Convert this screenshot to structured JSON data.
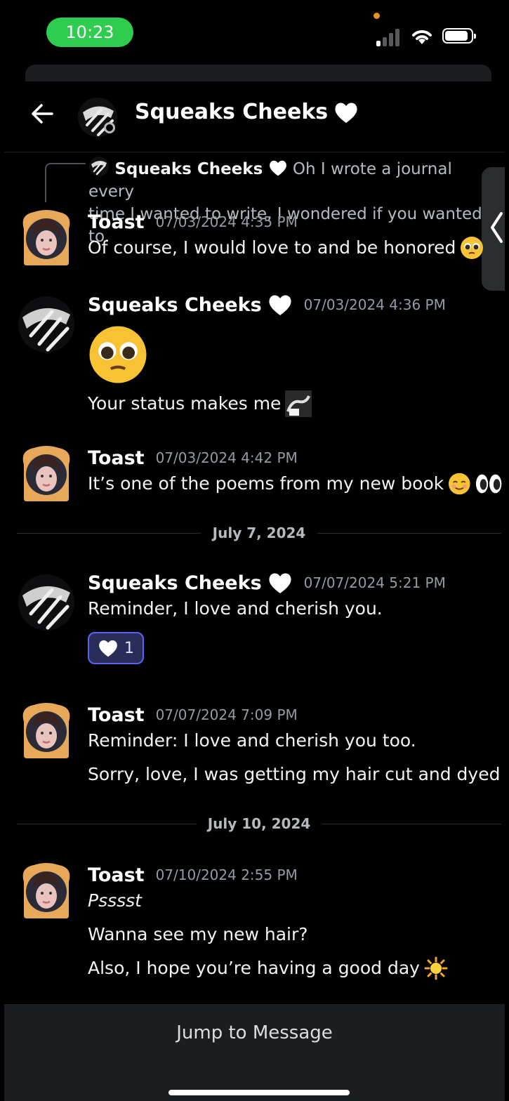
{
  "status_bar": {
    "time": "10:23",
    "battery_level": 0.88,
    "signal_bars": 1
  },
  "header": {
    "back_icon": "arrow-left-icon",
    "title": "Squeaks Cheeks"
  },
  "reply": {
    "author": "Squeaks Cheeks",
    "text_line1": "Oh I wrote a journal every",
    "text_line2": "time I wanted to write, I wondered if you wanted to."
  },
  "messages": [
    {
      "author": "Toast",
      "timestamp": "07/03/2024 4:35 PM",
      "lines": [
        "Of course, I would love to and be honored"
      ]
    },
    {
      "author": "Squeaks Cheeks",
      "timestamp": "07/03/2024 4:36 PM",
      "lines": [
        "Your status  makes me"
      ]
    },
    {
      "author": "Toast",
      "timestamp": "07/03/2024 4:42 PM",
      "lines": [
        "It’s one of the poems from my new book"
      ]
    },
    {
      "author": "Squeaks Cheeks",
      "timestamp": "07/07/2024 5:21 PM",
      "lines": [
        "Reminder, I love and cherish you."
      ],
      "reaction_count": "1"
    },
    {
      "author": "Toast",
      "timestamp": "07/07/2024 7:09 PM",
      "lines": [
        "Reminder: I love and cherish you too.",
        "Sorry, love, I was getting my hair cut and dyed"
      ]
    },
    {
      "author": "Toast",
      "timestamp": "07/10/2024 2:55 PM",
      "lines": [
        "Psssst",
        "Wanna see my new hair?",
        "Also, I hope you’re having a good day"
      ]
    }
  ],
  "dividers": [
    "July 7, 2024",
    "July 10, 2024"
  ],
  "bottom": {
    "jump_label": "Jump to Message"
  },
  "colors": {
    "accent": "#5865f2",
    "background": "#000000",
    "status_pill": "#2ecc4f"
  }
}
